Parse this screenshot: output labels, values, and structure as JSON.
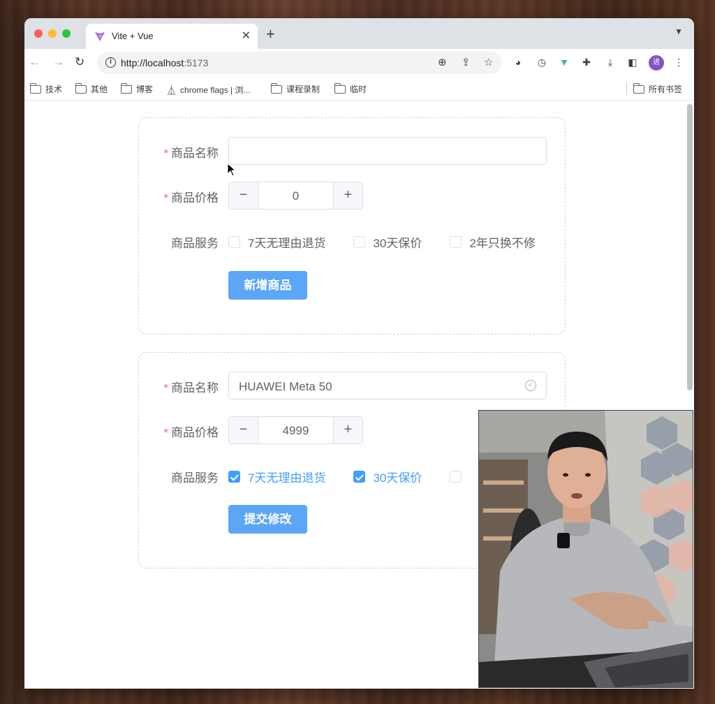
{
  "browser": {
    "tab_title": "Vite + Vue",
    "new_tab_icon": "+",
    "url_host": "http://localhost",
    "url_port": ":5173",
    "avatar_initial": "进"
  },
  "bookmarks": [
    {
      "label": "技术",
      "icon": "folder-icon"
    },
    {
      "label": "其他",
      "icon": "folder-icon"
    },
    {
      "label": "博客",
      "icon": "folder-icon"
    },
    {
      "label": "chrome flags | 浏...",
      "icon": "flask-icon"
    },
    {
      "label": "课程录制",
      "icon": "folder-icon"
    },
    {
      "label": "临时",
      "icon": "folder-icon"
    }
  ],
  "all_bookmarks": "所有书签",
  "form_add": {
    "name_label": "商品名称",
    "name_value": "",
    "price_label": "商品价格",
    "price_value": "0",
    "service_label": "商品服务",
    "services": [
      {
        "label": "7天无理由退货",
        "checked": false
      },
      {
        "label": "30天保价",
        "checked": false
      },
      {
        "label": "2年只换不修",
        "checked": false
      }
    ],
    "submit_label": "新增商品"
  },
  "form_edit": {
    "name_label": "商品名称",
    "name_value": "HUAWEI Meta 50",
    "price_label": "商品价格",
    "price_value": "4999",
    "service_label": "商品服务",
    "services": [
      {
        "label": "7天无理由退货",
        "checked": true
      },
      {
        "label": "30天保价",
        "checked": true
      }
    ],
    "submit_label": "提交修改"
  },
  "colors": {
    "primary": "#409eff",
    "required": "#f56c6c"
  }
}
